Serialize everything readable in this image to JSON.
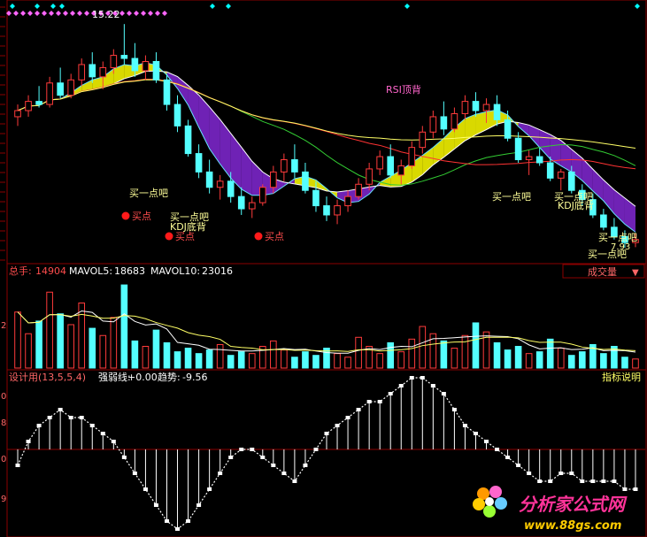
{
  "colors": {
    "background": "#000000",
    "frame": "#8b0000",
    "up_candle": "#ff3b3b",
    "down_candle": "#54ffff",
    "ma_white": "#ffffff",
    "ma_yellow": "#ffff66",
    "ma_green": "#33cc33",
    "ma_red": "#ff3333",
    "ma_cyan": "#66e0ff",
    "band_purple": "#8b2be2",
    "band_yellow": "#ffff00",
    "diamond_pink": "#ff66ff",
    "diamond_cyan": "#00ffff",
    "signal_red": "#ff1a1a",
    "text_yellow": "#ffff99",
    "label_pink": "#ff66cc"
  },
  "price_panel": {
    "top_label": "15.22",
    "annotations": {
      "rsi_top": "RSI顶背",
      "buy_a_bit": "买一点吧",
      "buy_a_bit_tail": "买一点吧",
      "buy_a_bit_cut": "买一点吧",
      "bottom_divergence": "KDJ底背",
      "buy_point": "买点",
      "price_low": "7.93",
      "buy_cut_a": "买一点吧",
      "buy_cut_b": "买一点吧"
    }
  },
  "volume_panel": {
    "label_total": "总手:",
    "total": "14904",
    "label_mavol5": "MAVOL5:",
    "mavol5": "18683",
    "label_mavol10": "MAVOL10:",
    "mavol10": "23016",
    "selector": "成交量",
    "selector_arrow": "▼",
    "axis_tick": "2"
  },
  "indicator_panel": {
    "label_design": "设计用(13,5,5,4)",
    "label_strength": "强弱线:",
    "strength": "+0.00",
    "label_trend": "趋势:",
    "trend": "-9.56",
    "help": "指标说明",
    "axis_ticks": [
      "0",
      "8",
      "0",
      "9"
    ]
  },
  "watermark": {
    "title": "分析家公式网",
    "url": "www.88gs.com"
  },
  "chart_data": {
    "type": "candlestick",
    "price_candles": [
      {
        "o": 12.2,
        "h": 12.6,
        "l": 11.9,
        "c": 12.4
      },
      {
        "o": 12.4,
        "h": 12.9,
        "l": 12.2,
        "c": 12.7
      },
      {
        "o": 12.7,
        "h": 13.2,
        "l": 12.5,
        "c": 12.6
      },
      {
        "o": 12.6,
        "h": 13.5,
        "l": 12.5,
        "c": 13.3
      },
      {
        "o": 13.3,
        "h": 13.8,
        "l": 12.8,
        "c": 12.9
      },
      {
        "o": 12.9,
        "h": 13.6,
        "l": 12.8,
        "c": 13.4
      },
      {
        "o": 13.4,
        "h": 14.1,
        "l": 13.2,
        "c": 13.9
      },
      {
        "o": 13.9,
        "h": 14.3,
        "l": 13.3,
        "c": 13.5
      },
      {
        "o": 13.5,
        "h": 14.0,
        "l": 13.1,
        "c": 13.8
      },
      {
        "o": 13.8,
        "h": 14.4,
        "l": 13.6,
        "c": 14.2
      },
      {
        "o": 14.2,
        "h": 15.22,
        "l": 13.9,
        "c": 14.1
      },
      {
        "o": 14.1,
        "h": 14.6,
        "l": 13.5,
        "c": 13.7
      },
      {
        "o": 13.7,
        "h": 14.2,
        "l": 13.4,
        "c": 14.0
      },
      {
        "o": 14.0,
        "h": 14.3,
        "l": 13.3,
        "c": 13.4
      },
      {
        "o": 13.4,
        "h": 13.6,
        "l": 12.4,
        "c": 12.6
      },
      {
        "o": 12.6,
        "h": 12.9,
        "l": 11.7,
        "c": 11.9
      },
      {
        "o": 11.9,
        "h": 12.1,
        "l": 10.9,
        "c": 11.0
      },
      {
        "o": 11.0,
        "h": 11.3,
        "l": 10.2,
        "c": 10.4
      },
      {
        "o": 10.4,
        "h": 10.8,
        "l": 9.7,
        "c": 9.9
      },
      {
        "o": 9.9,
        "h": 10.3,
        "l": 9.5,
        "c": 10.1
      },
      {
        "o": 10.1,
        "h": 10.4,
        "l": 9.4,
        "c": 9.6
      },
      {
        "o": 9.6,
        "h": 9.9,
        "l": 9.0,
        "c": 9.2
      },
      {
        "o": 9.2,
        "h": 9.6,
        "l": 8.9,
        "c": 9.4
      },
      {
        "o": 9.4,
        "h": 10.0,
        "l": 9.3,
        "c": 9.9
      },
      {
        "o": 9.9,
        "h": 10.6,
        "l": 9.7,
        "c": 10.4
      },
      {
        "o": 10.4,
        "h": 11.0,
        "l": 10.1,
        "c": 10.8
      },
      {
        "o": 10.8,
        "h": 11.3,
        "l": 10.2,
        "c": 10.4
      },
      {
        "o": 10.4,
        "h": 10.7,
        "l": 9.7,
        "c": 9.8
      },
      {
        "o": 9.8,
        "h": 10.1,
        "l": 9.1,
        "c": 9.3
      },
      {
        "o": 9.3,
        "h": 9.6,
        "l": 8.8,
        "c": 9.0
      },
      {
        "o": 9.0,
        "h": 9.5,
        "l": 8.7,
        "c": 9.3
      },
      {
        "o": 9.3,
        "h": 9.8,
        "l": 9.1,
        "c": 9.6
      },
      {
        "o": 9.6,
        "h": 10.2,
        "l": 9.5,
        "c": 10.0
      },
      {
        "o": 10.0,
        "h": 10.7,
        "l": 9.8,
        "c": 10.5
      },
      {
        "o": 10.5,
        "h": 11.1,
        "l": 10.3,
        "c": 10.9
      },
      {
        "o": 10.9,
        "h": 11.3,
        "l": 10.2,
        "c": 10.3
      },
      {
        "o": 10.3,
        "h": 10.8,
        "l": 10.0,
        "c": 10.6
      },
      {
        "o": 10.6,
        "h": 11.4,
        "l": 10.5,
        "c": 11.2
      },
      {
        "o": 11.2,
        "h": 11.9,
        "l": 11.0,
        "c": 11.7
      },
      {
        "o": 11.7,
        "h": 12.4,
        "l": 11.5,
        "c": 12.2
      },
      {
        "o": 12.2,
        "h": 12.7,
        "l": 11.6,
        "c": 11.8
      },
      {
        "o": 11.8,
        "h": 12.5,
        "l": 11.7,
        "c": 12.3
      },
      {
        "o": 12.3,
        "h": 12.9,
        "l": 12.1,
        "c": 12.7
      },
      {
        "o": 12.7,
        "h": 13.0,
        "l": 12.2,
        "c": 12.4
      },
      {
        "o": 12.4,
        "h": 12.8,
        "l": 12.0,
        "c": 12.6
      },
      {
        "o": 12.6,
        "h": 12.9,
        "l": 11.9,
        "c": 12.1
      },
      {
        "o": 12.1,
        "h": 12.4,
        "l": 11.4,
        "c": 11.5
      },
      {
        "o": 11.5,
        "h": 11.7,
        "l": 10.7,
        "c": 10.8
      },
      {
        "o": 10.8,
        "h": 11.1,
        "l": 10.3,
        "c": 10.9
      },
      {
        "o": 10.9,
        "h": 11.2,
        "l": 10.6,
        "c": 10.7
      },
      {
        "o": 10.7,
        "h": 10.9,
        "l": 10.1,
        "c": 10.2
      },
      {
        "o": 10.2,
        "h": 10.5,
        "l": 9.8,
        "c": 10.4
      },
      {
        "o": 10.4,
        "h": 10.6,
        "l": 9.7,
        "c": 9.8
      },
      {
        "o": 9.8,
        "h": 10.0,
        "l": 9.3,
        "c": 9.5
      },
      {
        "o": 9.5,
        "h": 9.7,
        "l": 8.9,
        "c": 9.0
      },
      {
        "o": 9.0,
        "h": 9.2,
        "l": 8.5,
        "c": 8.6
      },
      {
        "o": 8.6,
        "h": 8.9,
        "l": 8.2,
        "c": 8.3
      },
      {
        "o": 8.3,
        "h": 8.5,
        "l": 7.93,
        "c": 8.1
      },
      {
        "o": 8.1,
        "h": 8.4,
        "l": 7.95,
        "c": 8.2
      }
    ],
    "volumes": [
      3.1,
      1.9,
      2.6,
      4.2,
      3.0,
      2.4,
      3.6,
      2.2,
      1.8,
      2.8,
      4.6,
      1.5,
      1.2,
      2.1,
      1.4,
      0.9,
      1.1,
      0.8,
      1.0,
      1.3,
      0.7,
      0.9,
      0.8,
      1.2,
      1.5,
      1.0,
      0.6,
      0.9,
      0.7,
      1.1,
      0.8,
      0.6,
      1.7,
      1.2,
      0.8,
      1.4,
      0.9,
      1.6,
      2.3,
      1.9,
      1.5,
      1.1,
      1.8,
      2.5,
      2.0,
      1.4,
      1.0,
      1.2,
      0.8,
      0.9,
      1.6,
      1.1,
      0.7,
      0.9,
      1.3,
      0.8,
      1.2,
      0.6,
      0.5
    ],
    "indicator": [
      -2,
      1,
      3,
      4,
      5,
      4,
      4,
      3,
      2,
      1,
      -1,
      -3,
      -5,
      -7,
      -9,
      -10,
      -9,
      -7,
      -5,
      -3,
      -1,
      0,
      0,
      -1,
      -2,
      -3,
      -4,
      -2,
      0,
      2,
      3,
      4,
      5,
      6,
      6,
      7,
      8,
      9,
      9,
      8,
      7,
      5,
      3,
      2,
      1,
      0,
      -1,
      -2,
      -3,
      -4,
      -4,
      -3,
      -3,
      -4,
      -4,
      -4,
      -4,
      -5,
      -5
    ]
  }
}
